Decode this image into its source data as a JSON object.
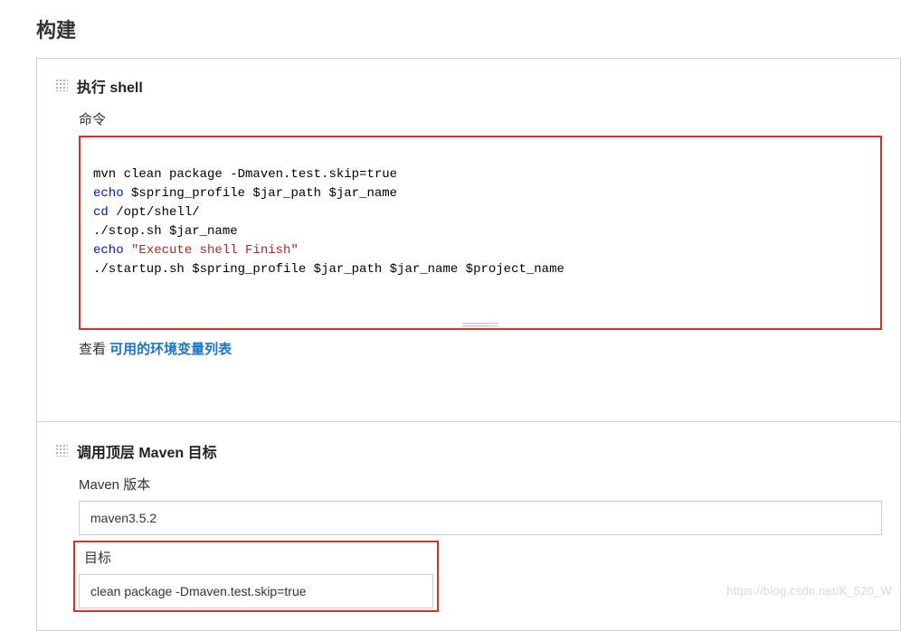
{
  "section_title": "构建",
  "shell_step": {
    "title": "执行 shell",
    "command_label": "命令",
    "code": {
      "line1_black": "mvn clean package -Dmaven.test.skip=true",
      "line2_blue_echo": "echo",
      "line2_black": " $spring_profile $jar_path $jar_name",
      "line3_blue_cd": "cd",
      "line3_black": " /opt/shell/",
      "line4_black": "./stop.sh $jar_name",
      "line5_blue_echo": "echo",
      "line5_maroon": " \"Execute shell Finish\"",
      "line6_black": "./startup.sh $spring_profile $jar_path $jar_name $project_name"
    },
    "see_label": "查看 ",
    "see_link": "可用的环境变量列表"
  },
  "maven_step": {
    "title": "调用顶层 Maven 目标",
    "version_label": "Maven 版本",
    "version_value": "maven3.5.2",
    "goals_label": "目标",
    "goals_value": "clean package -Dmaven.test.skip=true"
  },
  "watermark": "https://blog.csdn.net/K_520_W"
}
